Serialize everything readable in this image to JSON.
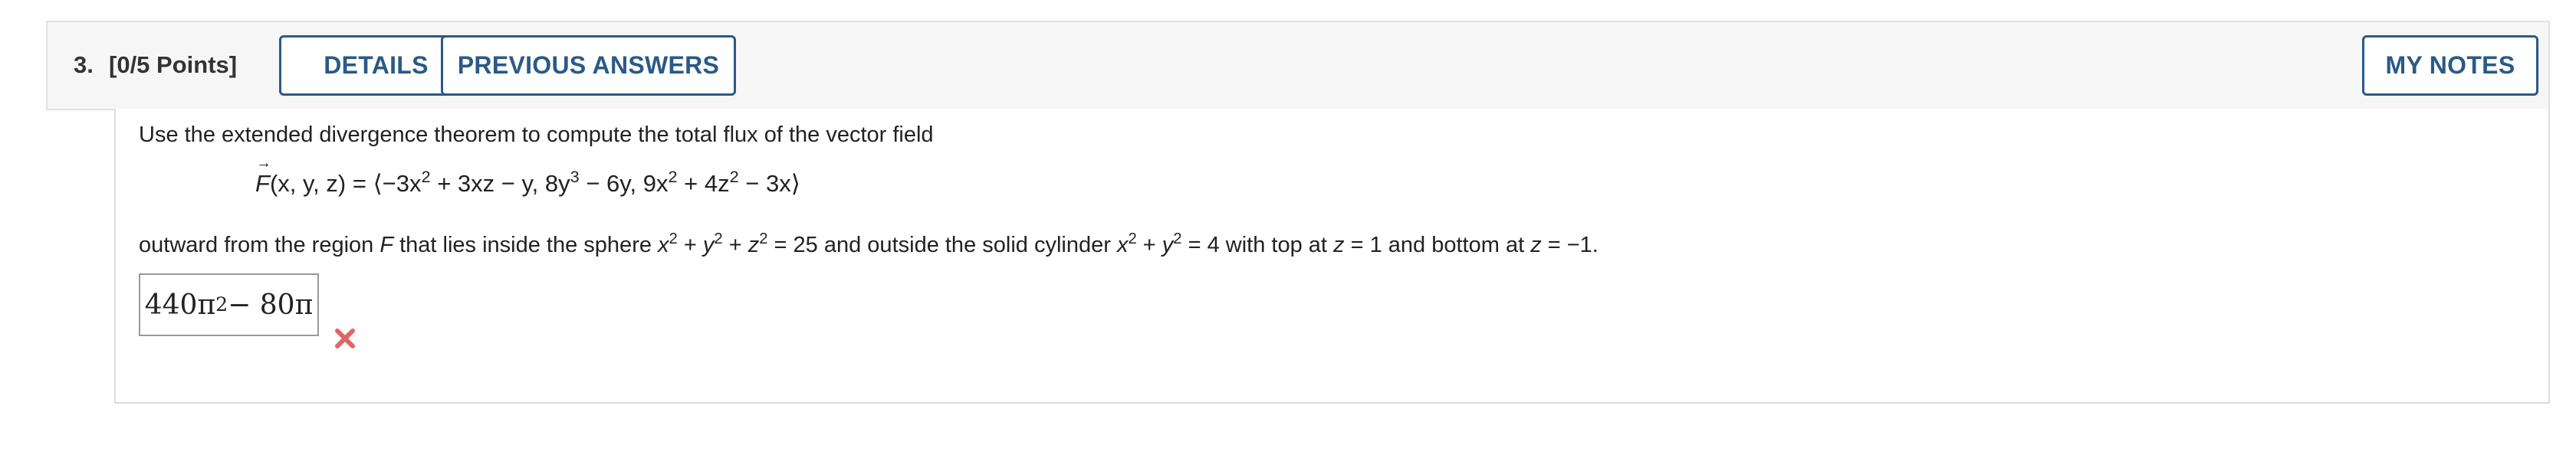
{
  "question": {
    "number": "3.",
    "points": "[0/5 Points]"
  },
  "buttons": {
    "details": "DETAILS",
    "previous_answers": "PREVIOUS ANSWERS",
    "my_notes": "MY NOTES"
  },
  "problem": {
    "intro": "Use the extended divergence theorem to compute the total flux of the vector field",
    "formula": {
      "F": "F",
      "args": "(x, y, z) = ⟨−3x",
      "p1": "2",
      "t2": " + 3xz − y, 8y",
      "p2": "3",
      "t3": " − 6y, 9x",
      "p3": "2",
      "t4": " + 4z",
      "p4": "2",
      "t5": " − 3x⟩"
    },
    "region": {
      "t1": "outward from the region ",
      "F": "F",
      "t2": " that lies inside the sphere ",
      "x1": "x",
      "p1": "2",
      "t3": " + ",
      "y1": "y",
      "p2": "2",
      "t4": " + ",
      "z1": "z",
      "p3": "2",
      "t5": " = 25 and outside the solid cylinder ",
      "x2": "x",
      "p4": "2",
      "t6": " + ",
      "y2": "y",
      "p5": "2",
      "t7": " = 4 with top at ",
      "z2": "z",
      "t8": " = 1 and bottom at ",
      "z3": "z",
      "t9": " = −1."
    }
  },
  "answer": {
    "a1": "440π",
    "power": "2",
    "a2": " − 80π",
    "status_icon": "x-mark-icon",
    "status_color": "#e06666"
  },
  "colors": {
    "accent": "#2a5a87"
  }
}
